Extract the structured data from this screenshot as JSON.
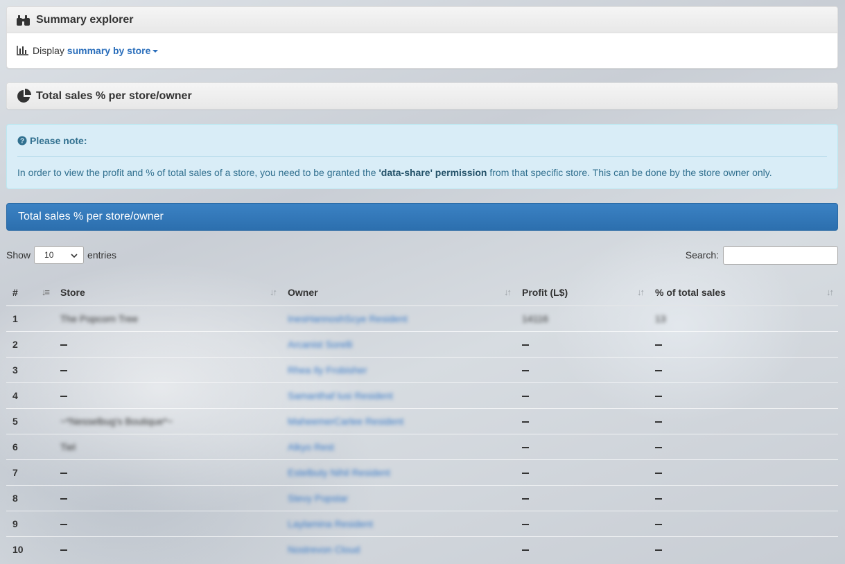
{
  "summary_panel": {
    "title": "Summary explorer",
    "display_label": "Display",
    "display_value": "summary by store"
  },
  "sales_panel": {
    "title": "Total sales % per store/owner"
  },
  "note": {
    "title": "Please note:",
    "text_before": "In order to view the profit and % of total sales of a store, you need to be granted the ",
    "permission": "'data-share' permission",
    "text_after": " from that specific store. This can be done by the store owner only."
  },
  "table_bar": {
    "title": "Total sales % per store/owner"
  },
  "controls": {
    "show_label": "Show",
    "page_size": "10",
    "entries_label": "entries",
    "search_label": "Search:"
  },
  "table": {
    "headers": [
      "#",
      "Store",
      "Owner",
      "Profit (L$)",
      "% of total sales"
    ],
    "rows": [
      {
        "num": "1",
        "store": "The Popcorn Tree",
        "owner": "InesHannoshScye Resident",
        "profit": "14116",
        "pct": "13"
      },
      {
        "num": "2",
        "store": "",
        "owner": "Arcanist Sorelli",
        "profit": "",
        "pct": ""
      },
      {
        "num": "3",
        "store": "",
        "owner": "Rhea Ily Frobisher",
        "profit": "",
        "pct": ""
      },
      {
        "num": "4",
        "store": "",
        "owner": "Samanthaf lusi Resident",
        "profit": "",
        "pct": ""
      },
      {
        "num": "5",
        "store": "~*Nesselbug's Boutique*~",
        "owner": "MaheemerCarlee Resident",
        "profit": "",
        "pct": ""
      },
      {
        "num": "6",
        "store": "Tiel",
        "owner": "Alkyo Rest",
        "profit": "",
        "pct": ""
      },
      {
        "num": "7",
        "store": "",
        "owner": "Estelbuty Nihil Resident",
        "profit": "",
        "pct": ""
      },
      {
        "num": "8",
        "store": "",
        "owner": "Stevy Popstar",
        "profit": "",
        "pct": ""
      },
      {
        "num": "9",
        "store": "",
        "owner": "Laylamina Resident",
        "profit": "",
        "pct": ""
      },
      {
        "num": "10",
        "store": "",
        "owner": "Nostrevon Cloud",
        "profit": "",
        "pct": ""
      }
    ]
  }
}
